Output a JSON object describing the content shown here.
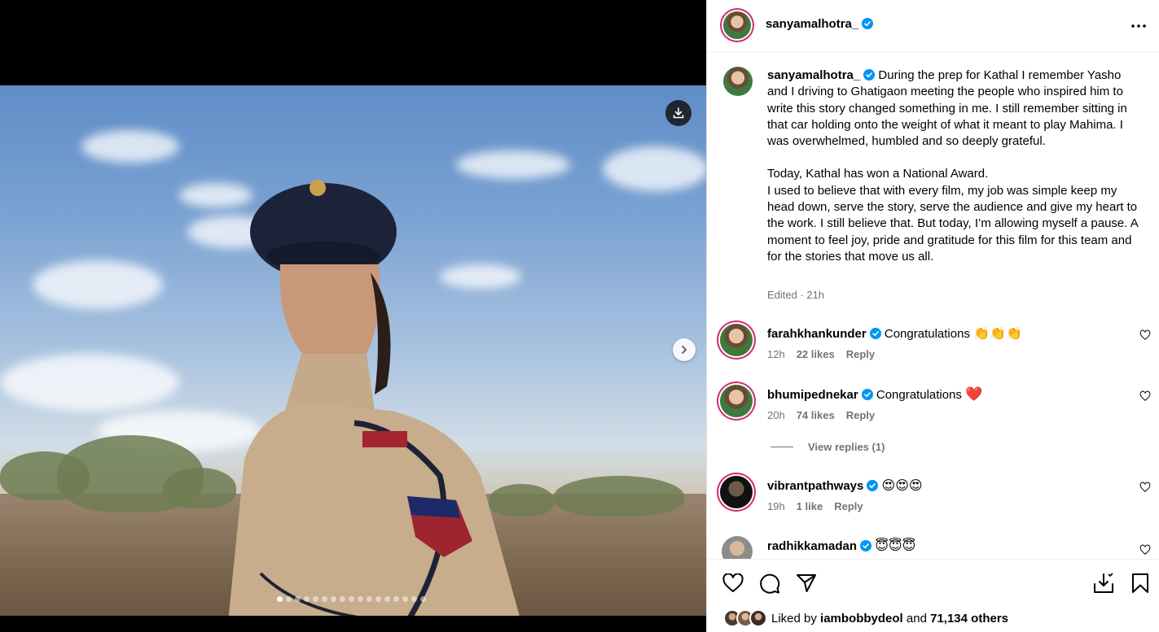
{
  "post": {
    "username": "sanyamalhotra_",
    "caption_p1": "During the prep for Kathal I remember Yasho and I driving to Ghatigaon meeting the people who inspired him to write this story changed something in me. I still remember sitting in that car holding onto the weight of what it meant to play Mahima. I was overwhelmed, humbled and so deeply grateful.",
    "caption_p2": "Today, Kathal has won a National Award.",
    "caption_p3": "I used to believe that with every film, my job was simple keep my head down, serve the story, serve the audience and give my heart to the work. I still believe that. But today, I’m allowing myself a pause. A moment to feel joy, pride and gratitude for this film for this team and for the stories that move us all.",
    "meta": "Edited · 21h"
  },
  "comments": [
    {
      "user": "farahkhankunder",
      "text": "Congratulations",
      "emoji": "👏👏👏",
      "time": "12h",
      "likes": "22 likes",
      "reply": "Reply"
    },
    {
      "user": "bhumipednekar",
      "text": "Congratulations",
      "emoji": "❤️",
      "time": "20h",
      "likes": "74 likes",
      "reply": "Reply"
    },
    {
      "user": "vibrantpathways",
      "text": "",
      "emoji": "😍😍😍",
      "time": "19h",
      "likes": "1 like",
      "reply": "Reply"
    },
    {
      "user": "radhikkamadan",
      "text": "",
      "emoji": "😇😇😇",
      "time": "",
      "likes": "",
      "reply": ""
    }
  ],
  "view_replies": "View replies (1)",
  "likes": {
    "prefix": "Liked by",
    "user": "iambobbydeol",
    "and": "and",
    "count": "71,134 others"
  },
  "carousel": {
    "total": 17,
    "active": 0
  },
  "colors": {
    "verified": "#0095f6",
    "text_secondary": "#737373",
    "story_ring": "#d62976",
    "heart": "#ed1c24"
  },
  "icons": [
    "download-icon",
    "chevron-right-icon",
    "more-icon",
    "heart-icon",
    "comment-icon",
    "share-icon",
    "save-icon",
    "bookmark-icon",
    "verified-icon"
  ]
}
